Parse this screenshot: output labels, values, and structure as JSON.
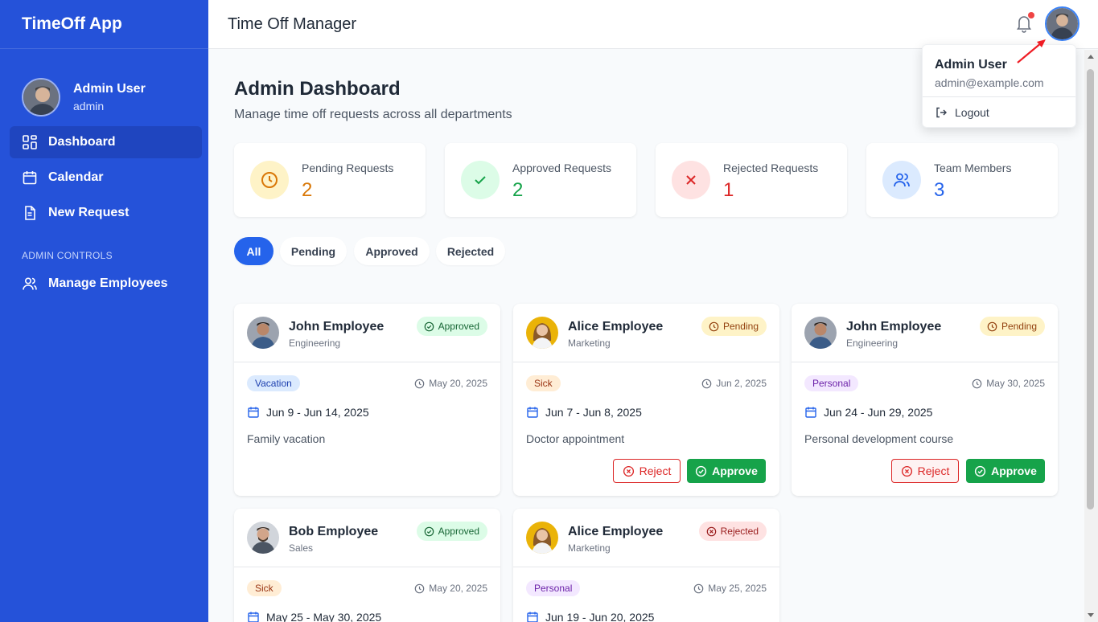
{
  "sidebar": {
    "brand": "TimeOff App",
    "user": {
      "name": "Admin User",
      "role": "admin"
    },
    "nav": [
      {
        "label": "Dashboard",
        "icon": "dashboard-grid-icon",
        "active": true
      },
      {
        "label": "Calendar",
        "icon": "calendar-icon",
        "active": false
      },
      {
        "label": "New Request",
        "icon": "document-icon",
        "active": false
      }
    ],
    "admin_section_label": "ADMIN CONTROLS",
    "admin_nav": [
      {
        "label": "Manage Employees",
        "icon": "users-icon"
      }
    ]
  },
  "header": {
    "title": "Time Off Manager",
    "notification_icon": "bell-icon",
    "has_notification": true
  },
  "page": {
    "title": "Admin Dashboard",
    "subtitle": "Manage time off requests across all departments"
  },
  "stats": [
    {
      "label": "Pending Requests",
      "value": "2",
      "icon": "clock-icon",
      "color": "#d97706",
      "bg": "#fef3c7"
    },
    {
      "label": "Approved Requests",
      "value": "2",
      "icon": "check-icon",
      "color": "#16a34a",
      "bg": "#dcfce7"
    },
    {
      "label": "Rejected Requests",
      "value": "1",
      "icon": "x-icon",
      "color": "#dc2626",
      "bg": "#fee2e2"
    },
    {
      "label": "Team Members",
      "value": "3",
      "icon": "users-icon",
      "color": "#2563eb",
      "bg": "#dbeafe"
    }
  ],
  "filters": [
    {
      "label": "All",
      "active": true
    },
    {
      "label": "Pending",
      "active": false
    },
    {
      "label": "Approved",
      "active": false
    },
    {
      "label": "Rejected",
      "active": false
    }
  ],
  "requests": [
    {
      "name": "John Employee",
      "department": "Engineering",
      "status": "Approved",
      "type": "Vacation",
      "submitted": "May 20, 2025",
      "dates": "Jun 9 - Jun 14, 2025",
      "reason": "Family vacation"
    },
    {
      "name": "Alice Employee",
      "department": "Marketing",
      "status": "Pending",
      "type": "Sick",
      "submitted": "Jun 2, 2025",
      "dates": "Jun 7 - Jun 8, 2025",
      "reason": "Doctor appointment"
    },
    {
      "name": "John Employee",
      "department": "Engineering",
      "status": "Pending",
      "type": "Personal",
      "submitted": "May 30, 2025",
      "dates": "Jun 24 - Jun 29, 2025",
      "reason": "Personal development course"
    },
    {
      "name": "Bob Employee",
      "department": "Sales",
      "status": "Approved",
      "type": "Sick",
      "submitted": "May 20, 2025",
      "dates": "May 25 - May 30, 2025",
      "reason": ""
    },
    {
      "name": "Alice Employee",
      "department": "Marketing",
      "status": "Rejected",
      "type": "Personal",
      "submitted": "May 25, 2025",
      "dates": "Jun 19 - Jun 20, 2025",
      "reason": ""
    }
  ],
  "actions": {
    "reject_label": "Reject",
    "approve_label": "Approve"
  },
  "dropdown": {
    "name": "Admin User",
    "email": "admin@example.com",
    "logout_label": "Logout"
  },
  "colors": {
    "sidebar": "#2552d9",
    "primary": "#2563eb",
    "approve": "#16a34a",
    "reject": "#dc2626"
  }
}
